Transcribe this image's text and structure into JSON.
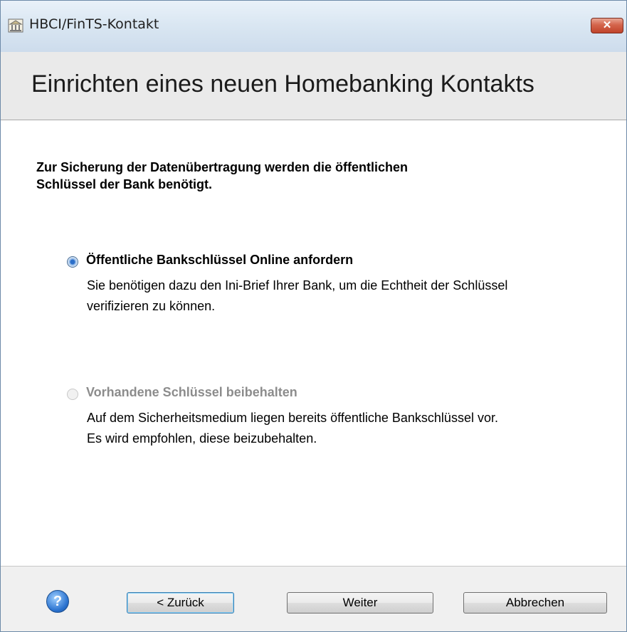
{
  "window": {
    "title": "HBCI/FinTS-Kontakt",
    "close_label": "✕"
  },
  "header": {
    "title": "Einrichten eines neuen Homebanking Kontakts"
  },
  "main": {
    "intro_line1": "Zur Sicherung der Datenübertragung werden die öffentlichen",
    "intro_line2": "Schlüssel der Bank benötigt.",
    "options": [
      {
        "label": "Öffentliche Bankschlüssel Online anfordern",
        "desc_line1": "Sie benötigen dazu den Ini-Brief Ihrer Bank, um die Echtheit der Schlüssel",
        "desc_line2": "verifizieren zu können.",
        "selected": true,
        "enabled": true
      },
      {
        "label": "Vorhandene Schlüssel beibehalten",
        "desc_line1": "Auf dem Sicherheitsmedium liegen bereits öffentliche Bankschlüssel vor.",
        "desc_line2": "Es wird empfohlen, diese beizubehalten.",
        "selected": false,
        "enabled": false
      }
    ]
  },
  "footer": {
    "help_label": "?",
    "back_label": "< Zurück",
    "next_label": "Weiter",
    "cancel_label": "Abbrechen"
  },
  "colors": {
    "disabled_text": "#8c8c8c",
    "accent": "#2c6fc9",
    "close_button": "#c0432b"
  }
}
